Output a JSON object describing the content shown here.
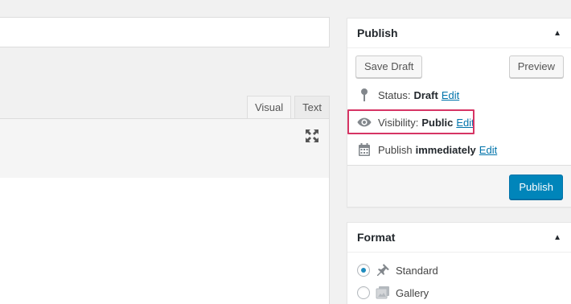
{
  "editor": {
    "title_value": "",
    "tabs": [
      {
        "label": "Visual",
        "active": true
      },
      {
        "label": "Text",
        "active": false
      }
    ]
  },
  "publish": {
    "title": "Publish",
    "save_draft_label": "Save Draft",
    "preview_label": "Preview",
    "status": {
      "label": "Status:",
      "value": "Draft",
      "edit": "Edit"
    },
    "visibility": {
      "label": "Visibility:",
      "value": "Public",
      "edit": "Edit"
    },
    "schedule": {
      "label": "Publish",
      "value": "immediately",
      "edit": "Edit"
    },
    "publish_label": "Publish"
  },
  "format": {
    "title": "Format",
    "options": [
      {
        "label": "Standard",
        "icon": "pushpin-icon",
        "checked": true
      },
      {
        "label": "Gallery",
        "icon": "gallery-icon",
        "checked": false
      }
    ]
  },
  "colors": {
    "highlight": "#d63464",
    "primary": "#0085ba",
    "link": "#0073aa"
  }
}
